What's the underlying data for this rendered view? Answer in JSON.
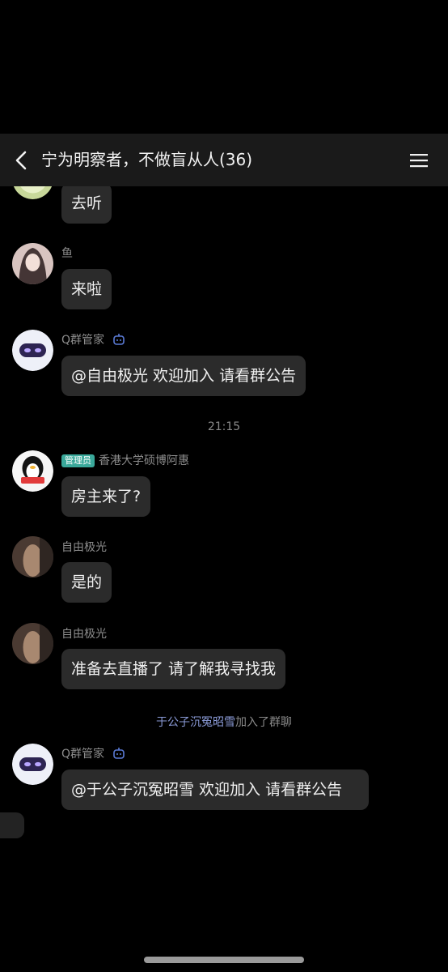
{
  "header": {
    "title": "宁为明察者，不做盲从人(36)"
  },
  "messages": [
    {
      "text": "去听"
    },
    {
      "sender": "鱼",
      "text": "来啦"
    },
    {
      "sender": "Q群管家",
      "text": "@自由极光 欢迎加入  请看群公告"
    },
    {
      "time": "21:15"
    },
    {
      "badge": "管理员",
      "sender": "香港大学硕博阿惠",
      "text": "房主来了?"
    },
    {
      "sender": "自由极光",
      "text": "是的"
    },
    {
      "sender": "自由极光",
      "text": "准备去直播了 请了解我寻找我"
    },
    {
      "system_name": "于公子沉冤昭雪",
      "system_suffix": "加入了群聊"
    },
    {
      "sender": "Q群管家",
      "text": "@于公子沉冤昭雪 欢迎加入  请看群公告"
    }
  ],
  "icons": {
    "back": "chevron-left-icon",
    "menu": "hamburger-menu-icon",
    "bot": "robot-icon"
  },
  "colors": {
    "background": "#000000",
    "header": "#1a1a1a",
    "bubble": "#2b2b2b",
    "admin_badge": "#3aa89a",
    "bot_icon": "#5b7bd6",
    "system_highlight": "#8b9bd8"
  }
}
